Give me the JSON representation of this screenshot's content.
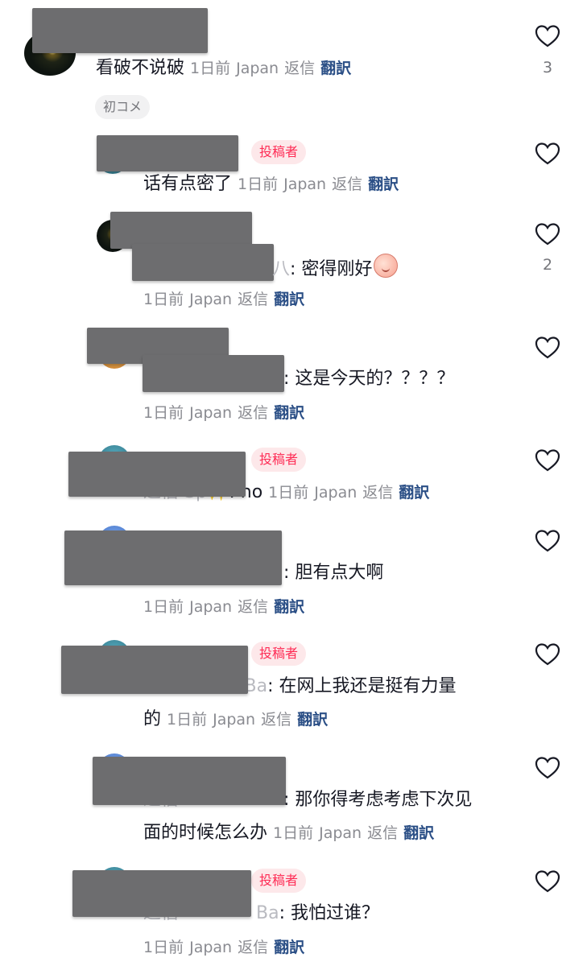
{
  "comment": {
    "text": "看破不说破",
    "time": "1日前",
    "region": "Japan",
    "reply_label": "返信",
    "translate_label": "翻訳",
    "likes": "3",
    "tag": "初コメ"
  },
  "replies": [
    {
      "badge": "投稿者",
      "text": "话有点密了",
      "time": "1日前",
      "region": "Japan",
      "reply_label": "返信",
      "translate_label": "翻訳"
    },
    {
      "name_tail": "八",
      "text": ": 密得刚好",
      "time": "1日前",
      "region": "Japan",
      "reply_label": "返信",
      "translate_label": "翻訳",
      "likes": "2"
    },
    {
      "text": ": 这是今天的？？？？",
      "time": "1日前",
      "region": "Japan",
      "reply_label": "返信",
      "translate_label": "翻訳"
    },
    {
      "badge": "投稿者",
      "prefix": "返信",
      "name_tail": "Sp",
      "text": ": no",
      "time": "1日前",
      "region": "Japan",
      "reply_label": "返信",
      "translate_label": "翻訳"
    },
    {
      "text": ": 胆有点大啊",
      "time": "1日前",
      "region": "Japan",
      "reply_label": "返信",
      "translate_label": "翻訳"
    },
    {
      "badge": "投稿者",
      "name_tail": "a Ba",
      "text": ": 在网上我还是挺有力量",
      "text2": "的",
      "time": "1日前",
      "region": "Japan",
      "reply_label": "返信",
      "translate_label": "翻訳"
    },
    {
      "prefix": "返信",
      "text": ": 那你得考虑考虑下次见",
      "text2": "面的时候怎么办",
      "time": "1日前",
      "region": "Japan",
      "reply_label": "返信",
      "translate_label": "翻訳"
    },
    {
      "badge": "投稿者",
      "prefix": "返信",
      "name_tail": "Ba",
      "text": ": 我怕过谁？",
      "time": "1日前",
      "region": "Japan",
      "reply_label": "返信",
      "translate_label": "翻訳"
    }
  ],
  "colors": {
    "badge_text": "#fe2c55",
    "translate": "#2b4f86",
    "meta": "#8a8b91",
    "redaction": "#6d6d6f"
  },
  "icons": {
    "like": "heart-outline-icon",
    "sparkle": "sparkle-emoji",
    "sticker": "blush-sticker"
  }
}
